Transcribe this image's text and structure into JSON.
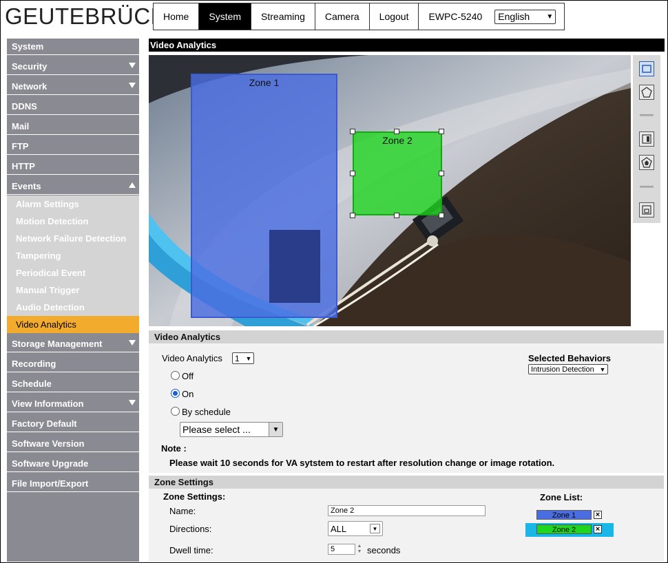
{
  "brand": "GEUTEBRÜCK",
  "topnav": {
    "tabs": [
      "Home",
      "System",
      "Streaming",
      "Camera",
      "Logout"
    ],
    "active": "System",
    "model": "EWPC-5240",
    "language": "English"
  },
  "sidebar": {
    "items": [
      "System",
      "Security",
      "Network",
      "DDNS",
      "Mail",
      "FTP",
      "HTTP",
      "Events"
    ],
    "events_sub": [
      "Alarm Settings",
      "Motion Detection",
      "Network Failure Detection",
      "Tampering",
      "Periodical Event",
      "Manual Trigger",
      "Audio Detection",
      "Video Analytics"
    ],
    "active_sub": "Video Analytics",
    "items_after": [
      "Storage Management",
      "Recording",
      "Schedule",
      "View Information",
      "Factory Default",
      "Software Version",
      "Software Upgrade",
      "File Import/Export"
    ]
  },
  "page_title": "Video Analytics",
  "video": {
    "zone1_label": "Zone 1",
    "zone2_label": "Zone 2"
  },
  "va_section": {
    "title": "Video Analytics",
    "va_label": "Video Analytics",
    "va_channel": "1",
    "options": [
      "Off",
      "On",
      "By schedule"
    ],
    "selected_option": "On",
    "schedule_placeholder": "Please select ...",
    "behaviors_label": "Selected Behaviors",
    "behavior_value": "Intrusion Detection",
    "note_label": "Note :",
    "note_text": "Please wait 10 seconds for VA sytstem to restart after resolution change or image rotation."
  },
  "zone_section": {
    "title": "Zone Settings",
    "subtitle": "Zone Settings:",
    "name_label": "Name:",
    "name_value": "Zone 2",
    "directions_label": "Directions:",
    "directions_value": "ALL",
    "dwell_label": "Dwell time:",
    "dwell_value": "5",
    "dwell_unit": "seconds",
    "zone_list_label": "Zone List:",
    "zones": [
      "Zone 1",
      "Zone 2"
    ],
    "selected_zone": "Zone 2"
  },
  "colors": {
    "zone1": "#4a6ee0",
    "zone2": "#1ed61e",
    "active_menu": "#f2ab2c",
    "sidebar": "#8a8a92",
    "selected_row": "#19b6e8"
  }
}
